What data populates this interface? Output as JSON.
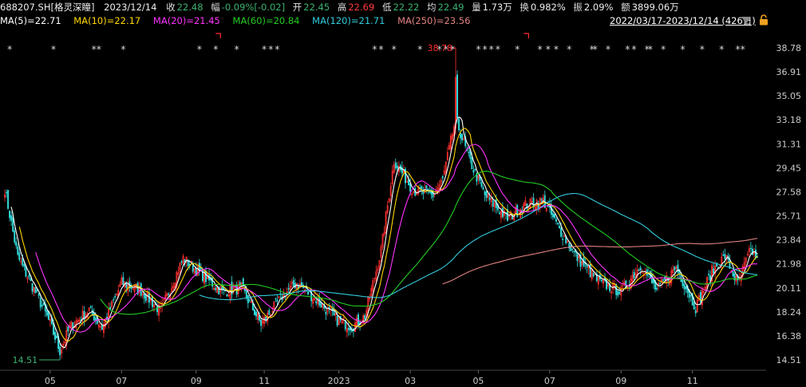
{
  "header": {
    "code": "688207.SH[格灵深瞳]",
    "date": "2023/12/14",
    "close_label": "收",
    "close": "22.48",
    "change_label": "幅",
    "change": "-0.09%[-0.02]",
    "open_label": "开",
    "open": "22.45",
    "high_label": "高",
    "high": "22.69",
    "low_label": "低",
    "low": "22.22",
    "avg_label": "均",
    "avg": "22.49",
    "volume_label": "量",
    "volume": "1.73万",
    "turnover_label": "换",
    "turnover": "0.982%",
    "amplitude_label": "振",
    "amplitude": "2.09%",
    "amount_label": "额",
    "amount": "3899.06万"
  },
  "ma": [
    {
      "label": "MA(5)=22.71",
      "color": "#ffffff"
    },
    {
      "label": "MA(10)=22.17",
      "color": "#ffd700"
    },
    {
      "label": "MA(20)=21.45",
      "color": "#ff33ff"
    },
    {
      "label": "MA(60)=20.84",
      "color": "#22cc22"
    },
    {
      "label": "MA(120)=21.71",
      "color": "#33ccdd"
    },
    {
      "label": "MA(250)=23.56",
      "color": "#e08080"
    }
  ],
  "range": "2022/03/17-2023/12/14 (426日)",
  "chart_data": {
    "type": "candlestick",
    "y_ticks": [
      "38.78",
      "36.91",
      "35.05",
      "33.18",
      "31.31",
      "29.45",
      "27.58",
      "25.71",
      "23.84",
      "21.98",
      "20.11",
      "18.24",
      "16.38",
      "14.51"
    ],
    "ylim": [
      14.51,
      38.78
    ],
    "x_ticks": [
      "05",
      "07",
      "09",
      "11",
      "2023",
      "03",
      "05",
      "07",
      "09",
      "11"
    ],
    "max_label": "38.78",
    "min_label": "14.51",
    "close_key_points": [
      [
        0,
        27.8
      ],
      [
        8,
        22.5
      ],
      [
        20,
        19.5
      ],
      [
        28,
        17.3
      ],
      [
        34,
        15.2
      ],
      [
        40,
        17.0
      ],
      [
        52,
        18.4
      ],
      [
        60,
        17.0
      ],
      [
        72,
        20.5
      ],
      [
        84,
        19.9
      ],
      [
        96,
        18.3
      ],
      [
        110,
        22.4
      ],
      [
        120,
        21.3
      ],
      [
        134,
        19.8
      ],
      [
        146,
        20.1
      ],
      [
        158,
        17.3
      ],
      [
        172,
        19.6
      ],
      [
        180,
        20.5
      ],
      [
        192,
        19.2
      ],
      [
        204,
        17.7
      ],
      [
        214,
        17.1
      ],
      [
        222,
        17.9
      ],
      [
        232,
        23.0
      ],
      [
        240,
        30.0
      ],
      [
        252,
        27.7
      ],
      [
        264,
        27.3
      ],
      [
        270,
        28.5
      ],
      [
        278,
        33.3
      ],
      [
        286,
        30.2
      ],
      [
        296,
        27.3
      ],
      [
        310,
        25.5
      ],
      [
        320,
        26.5
      ],
      [
        332,
        26.9
      ],
      [
        340,
        25.1
      ],
      [
        352,
        22.6
      ],
      [
        366,
        20.6
      ],
      [
        380,
        19.8
      ],
      [
        392,
        21.9
      ],
      [
        402,
        19.9
      ],
      [
        414,
        21.7
      ],
      [
        426,
        18.6
      ],
      [
        436,
        21.4
      ],
      [
        444,
        22.6
      ],
      [
        452,
        20.4
      ],
      [
        458,
        22.5
      ],
      [
        460,
        23.0
      ],
      [
        464,
        22.48
      ]
    ],
    "star_markers_x": [
      3,
      30,
      55,
      58,
      73,
      120,
      130,
      143,
      160,
      164,
      168,
      228,
      232,
      240,
      256,
      268,
      272,
      276,
      292,
      296,
      300,
      304,
      316,
      330,
      335,
      340,
      348,
      362,
      364,
      372,
      384,
      388,
      396,
      398,
      406,
      418,
      430,
      442,
      452,
      455
    ],
    "bracket_markers_x": [
      132,
      322
    ]
  }
}
